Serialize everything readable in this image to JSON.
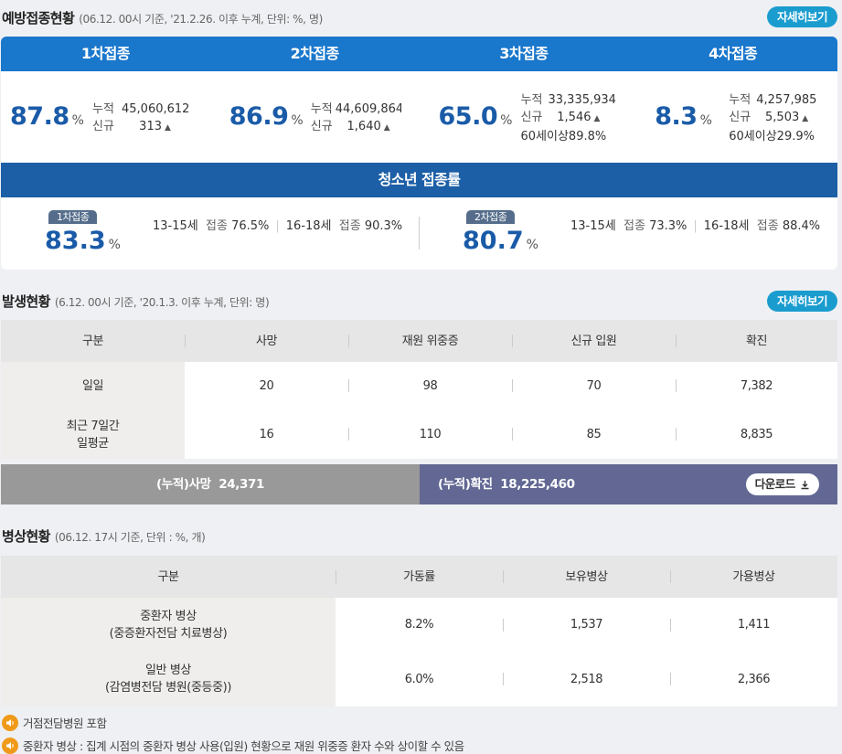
{
  "vaccination": {
    "title": "예방접종현황",
    "note": "(06.12. 00시 기준, '21.2.26. 이후 누계, 단위: %, 명)",
    "detail_label": "자세히보기",
    "doses": [
      {
        "label": "1차접종",
        "rate": "87.8",
        "unit": "%",
        "cum_label": "누적",
        "cum": "45,060,612",
        "new_label": "신규",
        "new": "313",
        "senior": ""
      },
      {
        "label": "2차접종",
        "rate": "86.9",
        "unit": "%",
        "cum_label": "누적",
        "cum": "44,609,864",
        "new_label": "신규",
        "new": "1,640",
        "senior": ""
      },
      {
        "label": "3차접종",
        "rate": "65.0",
        "unit": "%",
        "cum_label": "누적",
        "cum": "33,335,934",
        "new_label": "신규",
        "new": "1,546",
        "senior": "60세이상89.8%"
      },
      {
        "label": "4차접종",
        "rate": "8.3",
        "unit": "%",
        "cum_label": "누적",
        "cum": "4,257,985",
        "new_label": "신규",
        "new": "5,503",
        "senior": "60세이상29.9%"
      }
    ],
    "youth": {
      "title": "청소년 접종률",
      "groups": [
        {
          "badge": "1차접종",
          "rate": "83.3",
          "unit": "%",
          "a_age": "13-15세",
          "a_lbl": "접종",
          "a_val": "76.5%",
          "b_age": "16-18세",
          "b_lbl": "접종",
          "b_val": "90.3%"
        },
        {
          "badge": "2차접종",
          "rate": "80.7",
          "unit": "%",
          "a_age": "13-15세",
          "a_lbl": "접종",
          "a_val": "73.3%",
          "b_age": "16-18세",
          "b_lbl": "접종",
          "b_val": "88.4%"
        }
      ]
    }
  },
  "outbreak": {
    "title": "발생현황",
    "note": "(6.12. 00시 기준, '20.1.3. 이후 누계, 단위: 명)",
    "detail_label": "자세히보기",
    "headers": [
      "구분",
      "사망",
      "재원 위중증",
      "신규 입원",
      "확진"
    ],
    "rows": [
      {
        "label": "일일",
        "cells": [
          "20",
          "98",
          "70",
          "7,382"
        ]
      },
      {
        "label": "최근 7일간\n일평균",
        "cells": [
          "16",
          "110",
          "85",
          "8,835"
        ]
      }
    ],
    "cumulative": {
      "death_label": "(누적)사망",
      "death": "24,371",
      "confirmed_label": "(누적)확진",
      "confirmed": "18,225,460",
      "download_label": "다운로드"
    }
  },
  "beds": {
    "title": "병상현황",
    "note": "(06.12. 17시 기준, 단위 : %, 개)",
    "headers": [
      "구분",
      "가동률",
      "보유병상",
      "가용병상"
    ],
    "rows": [
      {
        "label": "중환자 병상\n(중증환자전담 치료병상)",
        "cells": [
          "8.2%",
          "1,537",
          "1,411"
        ]
      },
      {
        "label": "일반 병상\n(감염병전담 병원(중등중))",
        "cells": [
          "6.0%",
          "2,518",
          "2,366"
        ]
      }
    ],
    "notes": [
      "거점전담병원 포함",
      "중환자 병상 : 집계 시점의 중환자 병상 사용(입원) 현황으로 재원 위중증 환자 수와 상이할 수 있음"
    ]
  },
  "colors": {
    "accent": "#1a9ccf",
    "dose_bar": "#1977cc",
    "youth_bar": "#1c5fa6",
    "rate_text": "#1a5ba8",
    "cum_death": "#999999",
    "cum_confirmed": "#626893",
    "note_icon": "#f09a1a"
  }
}
